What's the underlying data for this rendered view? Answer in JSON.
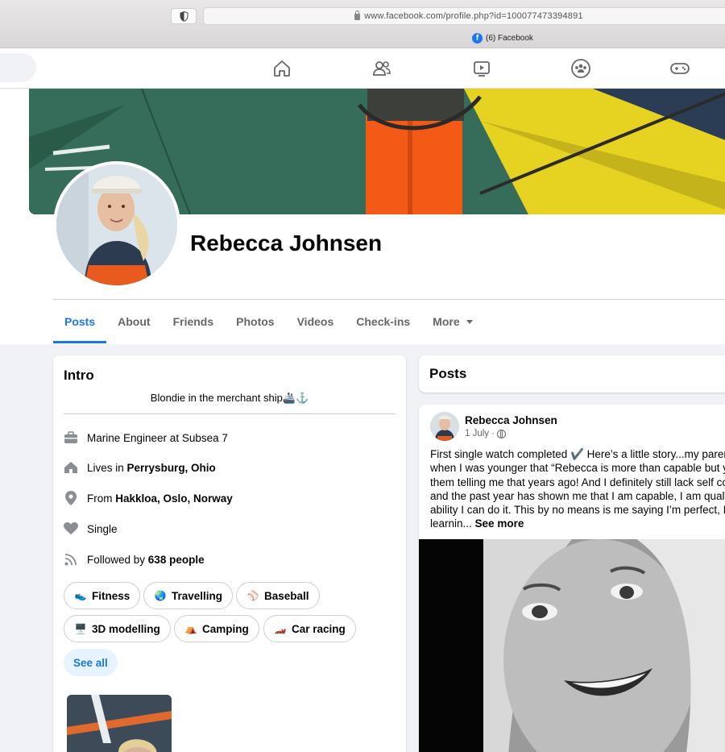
{
  "browser": {
    "url": "www.facebook.com/profile.php?id=100077473394891",
    "tab_title": "(6) Facebook",
    "favicon_letter": "f"
  },
  "nav_icons": [
    "home-icon",
    "friends-icon",
    "watch-icon",
    "groups-icon",
    "gaming-icon"
  ],
  "profile": {
    "name": "Rebecca Johnsen",
    "tabs": [
      "Posts",
      "About",
      "Friends",
      "Photos",
      "Videos",
      "Check-ins",
      "More"
    ],
    "active_tab": "Posts"
  },
  "intro": {
    "title": "Intro",
    "bio": "Blondie in the merchant ship🚢⚓",
    "work": "Marine Engineer at Subsea 7",
    "lives_prefix": "Lives in ",
    "lives_place": "Perrysburg, Ohio",
    "from_prefix": "From ",
    "from_place": "Hakkloa, Oslo, Norway",
    "relationship": "Single",
    "followed_prefix": "Followed by ",
    "followed_count": "638 people",
    "hobbies": [
      "Fitness",
      "Travelling",
      "Baseball",
      "3D modelling",
      "Camping",
      "Car racing"
    ],
    "hobby_emojis": [
      "👟",
      "🌏",
      "⚾",
      "🖥️",
      "⛺",
      "🏎️"
    ],
    "see_all": "See all"
  },
  "posts": {
    "header": "Posts",
    "author": "Rebecca Johnsen",
    "date": "1 July ·",
    "text_lines": [
      "First single watch completed ✔️ Here’s a little story...my parents told me",
      "when I was younger that “Rebecca is more than capable but you needed",
      "them telling me that years ago! And I definitely still lack self confidence",
      "and the past year has shown me that I am capable, I am qualified and",
      "ability I can do it. This by no means is me saying I’m perfect, I’m still"
    ],
    "last_line": "learnin...",
    "see_more": "See more"
  }
}
